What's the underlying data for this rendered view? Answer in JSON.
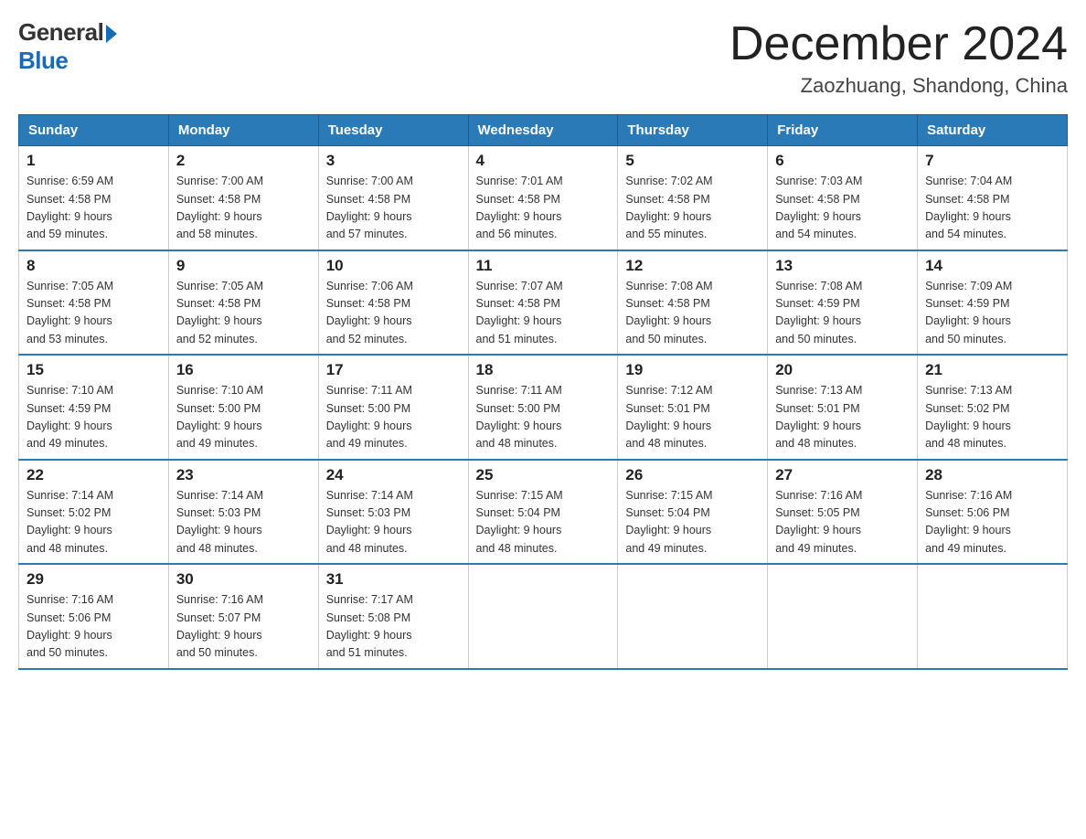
{
  "logo": {
    "general": "General",
    "blue": "Blue"
  },
  "title": "December 2024",
  "subtitle": "Zaozhuang, Shandong, China",
  "weekdays": [
    "Sunday",
    "Monday",
    "Tuesday",
    "Wednesday",
    "Thursday",
    "Friday",
    "Saturday"
  ],
  "weeks": [
    [
      {
        "day": "1",
        "sunrise": "6:59 AM",
        "sunset": "4:58 PM",
        "daylight": "9 hours and 59 minutes."
      },
      {
        "day": "2",
        "sunrise": "7:00 AM",
        "sunset": "4:58 PM",
        "daylight": "9 hours and 58 minutes."
      },
      {
        "day": "3",
        "sunrise": "7:00 AM",
        "sunset": "4:58 PM",
        "daylight": "9 hours and 57 minutes."
      },
      {
        "day": "4",
        "sunrise": "7:01 AM",
        "sunset": "4:58 PM",
        "daylight": "9 hours and 56 minutes."
      },
      {
        "day": "5",
        "sunrise": "7:02 AM",
        "sunset": "4:58 PM",
        "daylight": "9 hours and 55 minutes."
      },
      {
        "day": "6",
        "sunrise": "7:03 AM",
        "sunset": "4:58 PM",
        "daylight": "9 hours and 54 minutes."
      },
      {
        "day": "7",
        "sunrise": "7:04 AM",
        "sunset": "4:58 PM",
        "daylight": "9 hours and 54 minutes."
      }
    ],
    [
      {
        "day": "8",
        "sunrise": "7:05 AM",
        "sunset": "4:58 PM",
        "daylight": "9 hours and 53 minutes."
      },
      {
        "day": "9",
        "sunrise": "7:05 AM",
        "sunset": "4:58 PM",
        "daylight": "9 hours and 52 minutes."
      },
      {
        "day": "10",
        "sunrise": "7:06 AM",
        "sunset": "4:58 PM",
        "daylight": "9 hours and 52 minutes."
      },
      {
        "day": "11",
        "sunrise": "7:07 AM",
        "sunset": "4:58 PM",
        "daylight": "9 hours and 51 minutes."
      },
      {
        "day": "12",
        "sunrise": "7:08 AM",
        "sunset": "4:58 PM",
        "daylight": "9 hours and 50 minutes."
      },
      {
        "day": "13",
        "sunrise": "7:08 AM",
        "sunset": "4:59 PM",
        "daylight": "9 hours and 50 minutes."
      },
      {
        "day": "14",
        "sunrise": "7:09 AM",
        "sunset": "4:59 PM",
        "daylight": "9 hours and 50 minutes."
      }
    ],
    [
      {
        "day": "15",
        "sunrise": "7:10 AM",
        "sunset": "4:59 PM",
        "daylight": "9 hours and 49 minutes."
      },
      {
        "day": "16",
        "sunrise": "7:10 AM",
        "sunset": "5:00 PM",
        "daylight": "9 hours and 49 minutes."
      },
      {
        "day": "17",
        "sunrise": "7:11 AM",
        "sunset": "5:00 PM",
        "daylight": "9 hours and 49 minutes."
      },
      {
        "day": "18",
        "sunrise": "7:11 AM",
        "sunset": "5:00 PM",
        "daylight": "9 hours and 48 minutes."
      },
      {
        "day": "19",
        "sunrise": "7:12 AM",
        "sunset": "5:01 PM",
        "daylight": "9 hours and 48 minutes."
      },
      {
        "day": "20",
        "sunrise": "7:13 AM",
        "sunset": "5:01 PM",
        "daylight": "9 hours and 48 minutes."
      },
      {
        "day": "21",
        "sunrise": "7:13 AM",
        "sunset": "5:02 PM",
        "daylight": "9 hours and 48 minutes."
      }
    ],
    [
      {
        "day": "22",
        "sunrise": "7:14 AM",
        "sunset": "5:02 PM",
        "daylight": "9 hours and 48 minutes."
      },
      {
        "day": "23",
        "sunrise": "7:14 AM",
        "sunset": "5:03 PM",
        "daylight": "9 hours and 48 minutes."
      },
      {
        "day": "24",
        "sunrise": "7:14 AM",
        "sunset": "5:03 PM",
        "daylight": "9 hours and 48 minutes."
      },
      {
        "day": "25",
        "sunrise": "7:15 AM",
        "sunset": "5:04 PM",
        "daylight": "9 hours and 48 minutes."
      },
      {
        "day": "26",
        "sunrise": "7:15 AM",
        "sunset": "5:04 PM",
        "daylight": "9 hours and 49 minutes."
      },
      {
        "day": "27",
        "sunrise": "7:16 AM",
        "sunset": "5:05 PM",
        "daylight": "9 hours and 49 minutes."
      },
      {
        "day": "28",
        "sunrise": "7:16 AM",
        "sunset": "5:06 PM",
        "daylight": "9 hours and 49 minutes."
      }
    ],
    [
      {
        "day": "29",
        "sunrise": "7:16 AM",
        "sunset": "5:06 PM",
        "daylight": "9 hours and 50 minutes."
      },
      {
        "day": "30",
        "sunrise": "7:16 AM",
        "sunset": "5:07 PM",
        "daylight": "9 hours and 50 minutes."
      },
      {
        "day": "31",
        "sunrise": "7:17 AM",
        "sunset": "5:08 PM",
        "daylight": "9 hours and 51 minutes."
      },
      null,
      null,
      null,
      null
    ]
  ],
  "labels": {
    "sunrise": "Sunrise: ",
    "sunset": "Sunset: ",
    "daylight": "Daylight: "
  }
}
